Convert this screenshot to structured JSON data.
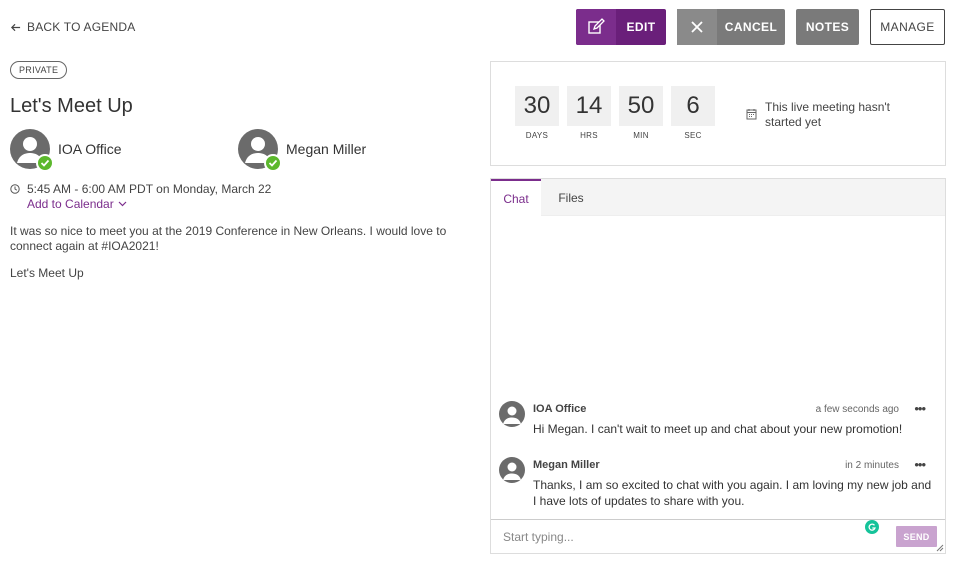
{
  "nav": {
    "back_label": "BACK TO AGENDA"
  },
  "toolbar": {
    "edit_label": "EDIT",
    "cancel_label": "CANCEL",
    "notes_label": "NOTES",
    "manage_label": "MANAGE"
  },
  "meeting": {
    "badge": "PRIVATE",
    "title": "Let's Meet Up",
    "attendees": [
      {
        "name": "IOA Office"
      },
      {
        "name": "Megan Miller"
      }
    ],
    "time": "5:45 AM - 6:00 AM PDT on Monday, March 22",
    "add_to_calendar": "Add to Calendar",
    "description": "It was so nice to meet you at the 2019 Conference in New Orleans. I would love to connect again at #IOA2021!",
    "description2": "Let's Meet Up"
  },
  "countdown": {
    "units": [
      {
        "value": "30",
        "label": "DAYS"
      },
      {
        "value": "14",
        "label": "HRS"
      },
      {
        "value": "50",
        "label": "MIN"
      },
      {
        "value": "6",
        "label": "SEC"
      }
    ],
    "status": "This live meeting hasn't started yet"
  },
  "chat": {
    "tabs": [
      {
        "label": "Chat",
        "active": true
      },
      {
        "label": "Files",
        "active": false
      }
    ],
    "messages": [
      {
        "author": "IOA Office",
        "time": "a few seconds ago",
        "text": "Hi Megan. I can't wait to meet up and chat about your new promotion!"
      },
      {
        "author": "Megan Miller",
        "time": "in 2 minutes",
        "text": "Thanks, I am so excited to chat with you again. I am loving my new job and I have lots of updates to share with you."
      }
    ],
    "composer_placeholder": "Start typing...",
    "send_label": "SEND"
  },
  "colors": {
    "accent": "#7b2d8c",
    "edit_bg": "#6a1f7a",
    "button_gray": "#7a7a7a",
    "check_green": "#5cb82d",
    "send_disabled": "#c9a3cf"
  }
}
